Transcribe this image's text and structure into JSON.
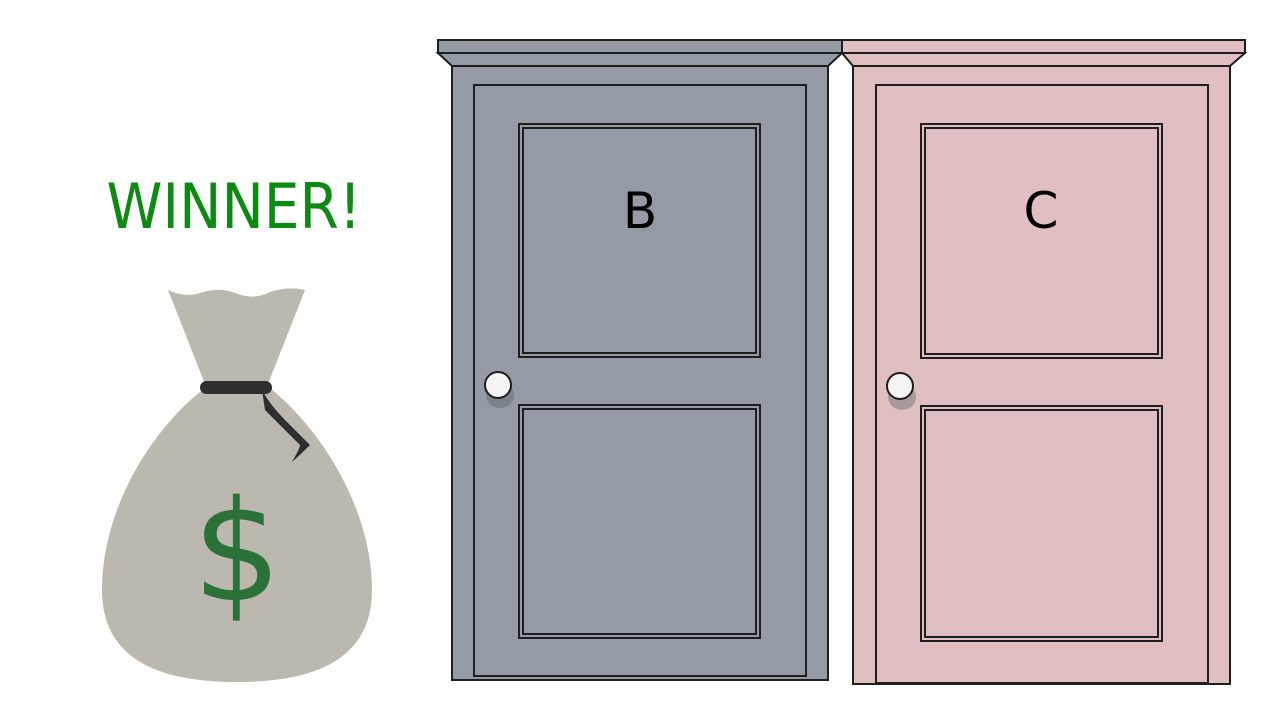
{
  "winner_text": "WINNER!",
  "money_symbol": "$",
  "doors": [
    {
      "label": "B",
      "color": "#959ba6"
    },
    {
      "label": "C",
      "color": "#dfbfc0"
    }
  ],
  "colors": {
    "winner": "#0c8a12",
    "bag": "#bcb8b0",
    "dollar": "#2a7238",
    "tie": "#2e2e2e"
  }
}
